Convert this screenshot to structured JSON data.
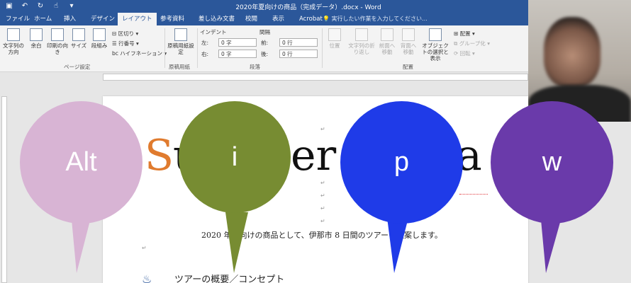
{
  "window": {
    "title": "2020年夏向けの商品（完成データ）.docx - Word"
  },
  "tabs": {
    "items": [
      "ファイル",
      "ホーム",
      "挿入",
      "デザイン",
      "レイアウト",
      "参考資料",
      "差し込み文書",
      "校閲",
      "表示",
      "Acrobat"
    ],
    "active": "レイアウト",
    "tell_me": "実行したい作業を入力してください..."
  },
  "ribbon": {
    "page_setup": {
      "text_direction": "文字列の方向",
      "margins": "余白",
      "orientation": "印刷の向き",
      "size": "サイズ",
      "columns": "段組み",
      "breaks": "区切り",
      "line_numbers": "行番号",
      "hyphenation": "ハイフネーション",
      "label": "ページ設定"
    },
    "manuscript": {
      "button": "原稿用紙設定",
      "label": "原稿用紙"
    },
    "paragraph": {
      "indent_header": "インデント",
      "spacing_header": "間隔",
      "left_label": "左:",
      "left_value": "0 字",
      "right_label": "右:",
      "right_value": "0 字",
      "before_label": "前:",
      "before_value": "0 行",
      "after_label": "後:",
      "after_value": "0 行",
      "label": "段落"
    },
    "arrange": {
      "position": "位置",
      "wrap_text": "文字列の折り返し",
      "bring_forward": "前面へ移動",
      "send_backward": "背面へ移動",
      "selection_pane": "オブジェクトの選択と表示",
      "align": "配置",
      "group": "グループ化",
      "rotate": "回転",
      "label": "配置"
    }
  },
  "document": {
    "big_letters": [
      "S",
      "u",
      "er",
      "a"
    ],
    "line1": "2020 年夏向けの商品として、伊那市 8 日間のツアーを提案します。",
    "line2": "ツアーの概要／コンセプト"
  },
  "bubbles": [
    {
      "label": "Alt",
      "color": "#d8b4d4"
    },
    {
      "label": "i",
      "color": "#778c32"
    },
    {
      "label": "p",
      "color": "#1f3be8"
    },
    {
      "label": "w",
      "color": "#6a3aaa"
    }
  ]
}
